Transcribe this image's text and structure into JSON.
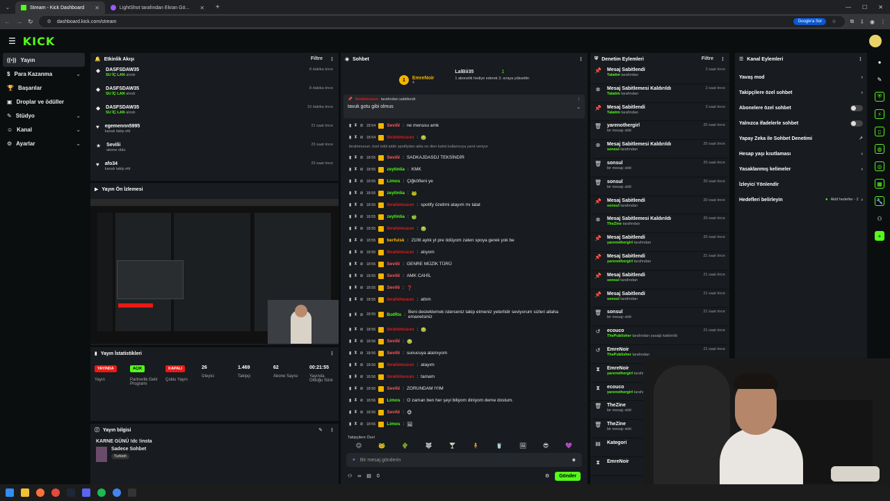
{
  "browser": {
    "tabs": [
      {
        "title": "Stream - Kick Dashboard"
      },
      {
        "title": "LightShot tarafından Ekran Gö..."
      }
    ],
    "url": "dashboard.kick.com/stream",
    "google_btn": "Google'a Sor"
  },
  "brand": {
    "logo": "KICK",
    "accent": "#53fc18"
  },
  "sidebar": {
    "items": [
      {
        "label": "Yayın",
        "icon": "broadcast-icon",
        "active": true
      },
      {
        "label": "Para Kazanma",
        "icon": "money-icon",
        "chevron": true
      },
      {
        "label": "Başarılar",
        "icon": "trophy-icon"
      },
      {
        "label": "Droplar ve ödüller",
        "icon": "gift-icon"
      },
      {
        "label": "Stüdyo",
        "icon": "studio-icon",
        "chevron": true
      },
      {
        "label": "Kanal",
        "icon": "user-icon",
        "chevron": true
      },
      {
        "label": "Ayarlar",
        "icon": "gear-icon",
        "chevron": true
      }
    ]
  },
  "activity": {
    "title": "Etkinlik Akışı",
    "filter": "Filtre",
    "items": [
      {
        "name": "DASFSDAW35",
        "sub_b": "SU İÇ LAN",
        "sub": "alındı",
        "time": "8 dakika önce"
      },
      {
        "name": "DASFSDAW35",
        "sub_b": "SU İÇ LAN",
        "sub": "alındı",
        "time": "8 dakika önce"
      },
      {
        "name": "DASFSDAW35",
        "sub_b": "SU İÇ LAN",
        "sub": "alındı",
        "time": "10 dakika önce"
      },
      {
        "name": "egemennn5995",
        "sub_b": "",
        "sub": "kanalı takip etti",
        "time": "21 saat önce"
      },
      {
        "name": "Sevilii",
        "sub_b": "",
        "sub": "abone oldu",
        "time": "23 saat önce"
      },
      {
        "name": "afo34",
        "sub_b": "",
        "sub": "kanalı takip etti",
        "time": "23 saat önce"
      }
    ]
  },
  "preview": {
    "title": "Yayın Ön İzlemesi"
  },
  "stats": {
    "title": "Yayın İstatistikleri",
    "cols": [
      {
        "badge": "YAYINDA",
        "badge_color": "#e91916",
        "label": "Yayın"
      },
      {
        "badge": "AÇIK",
        "badge_color": "#53fc18",
        "label": "Partnerlik Gelir Programı"
      },
      {
        "badge": "KAPALI",
        "badge_color": "#e91916",
        "label": "Çoklu Yayın"
      },
      {
        "value": "26",
        "label": "İzleyici"
      },
      {
        "value": "1.469",
        "label": "Takipçi"
      },
      {
        "value": "62",
        "label": "Abone Sayısı"
      },
      {
        "value": "00:21:55",
        "label": "Yayında Olduğu Süre"
      }
    ]
  },
  "info": {
    "title": "Yayın bilgisi",
    "stream_title": "KARNE GÜNÜ !dc !insta",
    "category": "Sadece Sohbet",
    "language": "Turkish"
  },
  "chat": {
    "title": "Sohbet",
    "top": {
      "user1": "EmreNoir",
      "user1_n": "4",
      "user2": "LalBii35",
      "user2_n": "1",
      "note": "1 abonelik hediye ederek 3. sıraya yükseltin"
    },
    "pinned": {
      "by": "tarafından sabitlendi",
      "pinner": "ibrahimusun",
      "text": "tavuk gotu gibi olmus"
    },
    "reply_hint": "ibrahimusun: özel ödül aldık spotifydan abla ne dion kalmi kullanıcıya yanıt veriyor",
    "messages": [
      {
        "t": "18:54",
        "u": "Sevilii",
        "c": "#ff5b5b",
        "m": "ne menusu amk"
      },
      {
        "t": "18:54",
        "u": "ibrahimusun",
        "c": "#e91916",
        "m": "🤢"
      },
      {
        "t": "18:55",
        "u": "Sevilii",
        "c": "#ff5b5b",
        "m": "SADKAJDASDJ TEKSİNDİR"
      },
      {
        "t": "18:55",
        "u": "zeytinlia",
        "c": "#53fc18",
        "m": "KMK"
      },
      {
        "t": "18:55",
        "u": "Limos",
        "c": "#53fc18",
        "m": "Çiğköfteni ye"
      },
      {
        "t": "18:55",
        "u": "zeytinlia",
        "c": "#53fc18",
        "m": "🐸"
      },
      {
        "t": "18:55",
        "u": "ibrahimusun",
        "c": "#e91916",
        "m": "spotify özetimi atayım mı talat"
      },
      {
        "t": "18:55",
        "u": "zeytinlia",
        "c": "#53fc18",
        "m": "🍏"
      },
      {
        "t": "18:55",
        "u": "ibrahimusun",
        "c": "#e91916",
        "m": "🤢"
      },
      {
        "t": "18:55",
        "u": "berfuisk",
        "c": "#ffb800",
        "m": "210tl aylık yt pre ödüyom zaten spoya gerek yok be"
      },
      {
        "t": "18:55",
        "u": "ibrahimusun",
        "c": "#e91916",
        "m": "atıyom"
      },
      {
        "t": "18:55",
        "u": "Sevilii",
        "c": "#ff5b5b",
        "m": "GENRE MÜZİK TÜRÜ"
      },
      {
        "t": "18:55",
        "u": "Sevilii",
        "c": "#ff5b5b",
        "m": "AMK CAHİL"
      },
      {
        "t": "18:55",
        "u": "Sevilii",
        "c": "#ff5b5b",
        "m": "❓"
      },
      {
        "t": "18:55",
        "u": "ibrahimusun",
        "c": "#e91916",
        "m": "attım"
      },
      {
        "t": "18:55",
        "u": "BotRix",
        "c": "#53fc18",
        "m": "Beni desteklemek isterseniz takip etmeniz yeterlidir seviyorum sizleri allaha emanetsiniz"
      },
      {
        "t": "18:56",
        "u": "ibrahimusun",
        "c": "#e91916",
        "m": "🤢"
      },
      {
        "t": "18:56",
        "u": "Sevilii",
        "c": "#ff5b5b",
        "m": "🤢"
      },
      {
        "t": "18:56",
        "u": "Sevilii",
        "c": "#ff5b5b",
        "m": "sunucuya atamıyom"
      },
      {
        "t": "18:56",
        "u": "ibrahimusun",
        "c": "#e91916",
        "m": "atayım"
      },
      {
        "t": "18:56",
        "u": "ibrahimusun",
        "c": "#e91916",
        "m": "tamam"
      },
      {
        "t": "18:56",
        "u": "Sevilii",
        "c": "#ff5b5b",
        "m": "ZORUNDAM IYIM"
      },
      {
        "t": "18:56",
        "u": "Limos",
        "c": "#53fc18",
        "m": "O zaman ben her şeyi biliyom diniyom deme dostum."
      },
      {
        "t": "18:56",
        "u": "Sevilii",
        "c": "#ff5b5b",
        "m": "🐵"
      },
      {
        "t": "18:56",
        "u": "Limos",
        "c": "#53fc18",
        "m": "🖼"
      }
    ],
    "followers_only": "Takipçilere Özel",
    "input_placeholder": "Bir mesaj gönderin",
    "send": "Gönder",
    "count": "0"
  },
  "modlog": {
    "title": "Denetim Eylemleri",
    "filter": "Filtre",
    "items": [
      {
        "icon": "pin-icon",
        "title": "Mesaj Sabitlendi",
        "by": "Talatim",
        "suffix": "tarafından",
        "time": "2 saat önce"
      },
      {
        "icon": "unpin-icon",
        "title": "Mesaj Sabitlemesi Kaldırıldı",
        "by": "Talatim",
        "suffix": "tarafından",
        "time": "2 saat önce"
      },
      {
        "icon": "pin-icon",
        "title": "Mesaj Sabitlendi",
        "by": "Talatim",
        "suffix": "tarafından",
        "time": "3 saat önce"
      },
      {
        "icon": "trash-icon",
        "title": "yarenothergirl",
        "by": "",
        "suffix": "bir mesajı sildi",
        "time": "20 saat önce"
      },
      {
        "icon": "unpin-icon",
        "title": "Mesaj Sabitlemesi Kaldırıldı",
        "by": "sonsul",
        "suffix": "tarafından",
        "time": "20 saat önce"
      },
      {
        "icon": "trash-icon",
        "title": "sonsul",
        "by": "",
        "suffix": "bir mesajı sildi",
        "time": "20 saat önce"
      },
      {
        "icon": "trash-icon",
        "title": "sonsul",
        "by": "",
        "suffix": "bir mesajı sildi",
        "time": "20 saat önce"
      },
      {
        "icon": "pin-icon",
        "title": "Mesaj Sabitlendi",
        "by": "sonsul",
        "suffix": "tarafından",
        "time": "20 saat önce"
      },
      {
        "icon": "unpin-icon",
        "title": "Mesaj Sabitlemesi Kaldırıldı",
        "by": "TheZine",
        "suffix": "tarafından",
        "time": "20 saat önce"
      },
      {
        "icon": "pin-icon",
        "title": "Mesaj Sabitlendi",
        "by": "yarenothergirl",
        "suffix": "tarafından",
        "time": "20 saat önce"
      },
      {
        "icon": "pin-icon",
        "title": "Mesaj Sabitlendi",
        "by": "yarenothergirl",
        "suffix": "tarafından",
        "time": "21 saat önce"
      },
      {
        "icon": "pin-icon",
        "title": "Mesaj Sabitlendi",
        "by": "sonsul",
        "suffix": "tarafından",
        "time": "21 saat önce"
      },
      {
        "icon": "pin-icon",
        "title": "Mesaj Sabitlendi",
        "by": "sonsul",
        "suffix": "tarafından",
        "time": "21 saat önce"
      },
      {
        "icon": "trash-icon",
        "title": "sonsul",
        "by": "",
        "suffix": "bir mesajı sildi",
        "time": "21 saat önce"
      },
      {
        "icon": "undo-icon",
        "title": "ecouco",
        "by": "ThePublisher",
        "suffix": "tarafından yasağı kaldırıldı",
        "time": "21 saat önce"
      },
      {
        "icon": "undo-icon",
        "title": "EmreNoir",
        "by": "ThePublisher",
        "suffix": "tarafından",
        "time": "21 saat önce"
      },
      {
        "icon": "timeout-icon",
        "title": "EmreNoir",
        "by": "yarenothergirl",
        "suffix": "tarafından uzaklaştırıldı",
        "time": ""
      },
      {
        "icon": "timeout-icon",
        "title": "ecouco",
        "by": "yarenothergirl",
        "suffix": "tarafından uzaklaştırıldı",
        "time": ""
      },
      {
        "icon": "trash-icon",
        "title": "TheZine",
        "by": "",
        "suffix": "bir mesajı sildi",
        "time": ""
      },
      {
        "icon": "trash-icon",
        "title": "TheZine",
        "by": "",
        "suffix": "bir mesajı sildi",
        "time": ""
      },
      {
        "icon": "category-icon",
        "title": "Kategori",
        "by": "",
        "suffix": "",
        "time": ""
      },
      {
        "icon": "timeout-icon",
        "title": "EmreNoir",
        "by": "",
        "suffix": "",
        "time": ""
      }
    ]
  },
  "channel_actions": {
    "title": "Kanal Eylemleri",
    "items": [
      {
        "label": "Yavaş mod",
        "type": "chevron"
      },
      {
        "label": "Takipçilere özel sohbet",
        "type": "chevron"
      },
      {
        "label": "Abonelere özel sohbet",
        "type": "toggle"
      },
      {
        "label": "Yalnızca ifadelerle sohbet",
        "type": "toggle"
      },
      {
        "label": "Yapay Zeka ile Sohbet Denetimi",
        "type": "external"
      },
      {
        "label": "Hesap yaşı kısıtlaması",
        "type": "chevron"
      },
      {
        "label": "Yasaklanmış kelimeler",
        "type": "chevron"
      },
      {
        "label": "İzleyici Yönlendir",
        "type": "none"
      },
      {
        "label": "Hedefleri belirleyin",
        "type": "goals",
        "extra": "Aktif hedefler - 2"
      }
    ]
  }
}
